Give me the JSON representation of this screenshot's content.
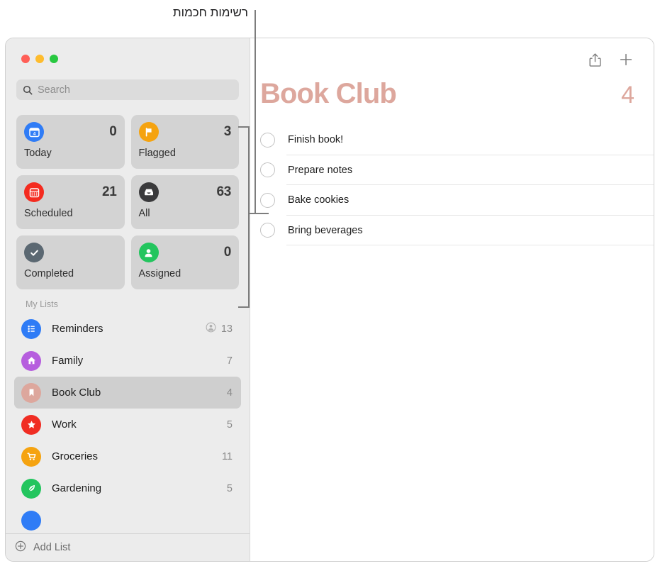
{
  "annotation": {
    "callout_text": "רשימות חכמות"
  },
  "window": {
    "traffic_lights": [
      {
        "name": "close",
        "color": "#ff5f57"
      },
      {
        "name": "minimize",
        "color": "#febc2e"
      },
      {
        "name": "zoom",
        "color": "#28c840"
      }
    ]
  },
  "sidebar": {
    "search": {
      "placeholder": "Search",
      "value": "",
      "icon": "search-icon"
    },
    "smart_lists": [
      {
        "id": "today",
        "label": "Today",
        "count": "0",
        "icon": "calendar-day-icon",
        "icon_color": "#2f7cf6",
        "badge_number": "4"
      },
      {
        "id": "flagged",
        "label": "Flagged",
        "count": "3",
        "icon": "flag-icon",
        "icon_color": "#f5a310"
      },
      {
        "id": "scheduled",
        "label": "Scheduled",
        "count": "21",
        "icon": "calendar-icon",
        "icon_color": "#f42b1f"
      },
      {
        "id": "all",
        "label": "All",
        "count": "63",
        "icon": "tray-icon",
        "icon_color": "#3a3a3c"
      },
      {
        "id": "completed",
        "label": "Completed",
        "count": "",
        "icon": "checkmark-icon",
        "icon_color": "#5b6872"
      },
      {
        "id": "assigned",
        "label": "Assigned",
        "count": "0",
        "icon": "person-icon",
        "icon_color": "#22c councils"
      }
    ],
    "my_lists_header": "My Lists",
    "my_lists": [
      {
        "id": "reminders",
        "label": "Reminders",
        "count": "13",
        "icon": "list-bullet-icon",
        "icon_color": "#2f7cf6",
        "shared": true,
        "selected": false
      },
      {
        "id": "family",
        "label": "Family",
        "count": "7",
        "icon": "house-icon",
        "icon_color": "#b65ede",
        "shared": false,
        "selected": false
      },
      {
        "id": "book-club",
        "label": "Book Club",
        "count": "4",
        "icon": "bookmark-icon",
        "icon_color": "#dda79d",
        "shared": false,
        "selected": true
      },
      {
        "id": "work",
        "label": "Work",
        "count": "5",
        "icon": "star-icon",
        "icon_color": "#f02d23",
        "shared": false,
        "selected": false
      },
      {
        "id": "groceries",
        "label": "Groceries",
        "count": "11",
        "icon": "cart-icon",
        "icon_color": "#f5a310",
        "shared": false,
        "selected": false
      },
      {
        "id": "gardening",
        "label": "Gardening",
        "count": "5",
        "icon": "leaf-icon",
        "icon_color": "#23c55e",
        "shared": false,
        "selected": false
      },
      {
        "id": "partial",
        "label": "",
        "count": "",
        "icon": "circle-icon",
        "icon_color": "#2f7cf6",
        "shared": false,
        "selected": false
      }
    ],
    "add_list": {
      "label": "Add List",
      "icon": "plus-circle-icon"
    }
  },
  "detail": {
    "toolbar": {
      "share_icon": "share-icon",
      "add_icon": "plus-icon"
    },
    "title": "Book Club",
    "count": "4",
    "accent_color": "#dda79d",
    "reminders": [
      {
        "text": "Finish book!",
        "completed": false
      },
      {
        "text": "Prepare notes",
        "completed": false
      },
      {
        "text": "Bake cookies",
        "completed": false
      },
      {
        "text": "Bring beverages",
        "completed": false
      }
    ]
  }
}
